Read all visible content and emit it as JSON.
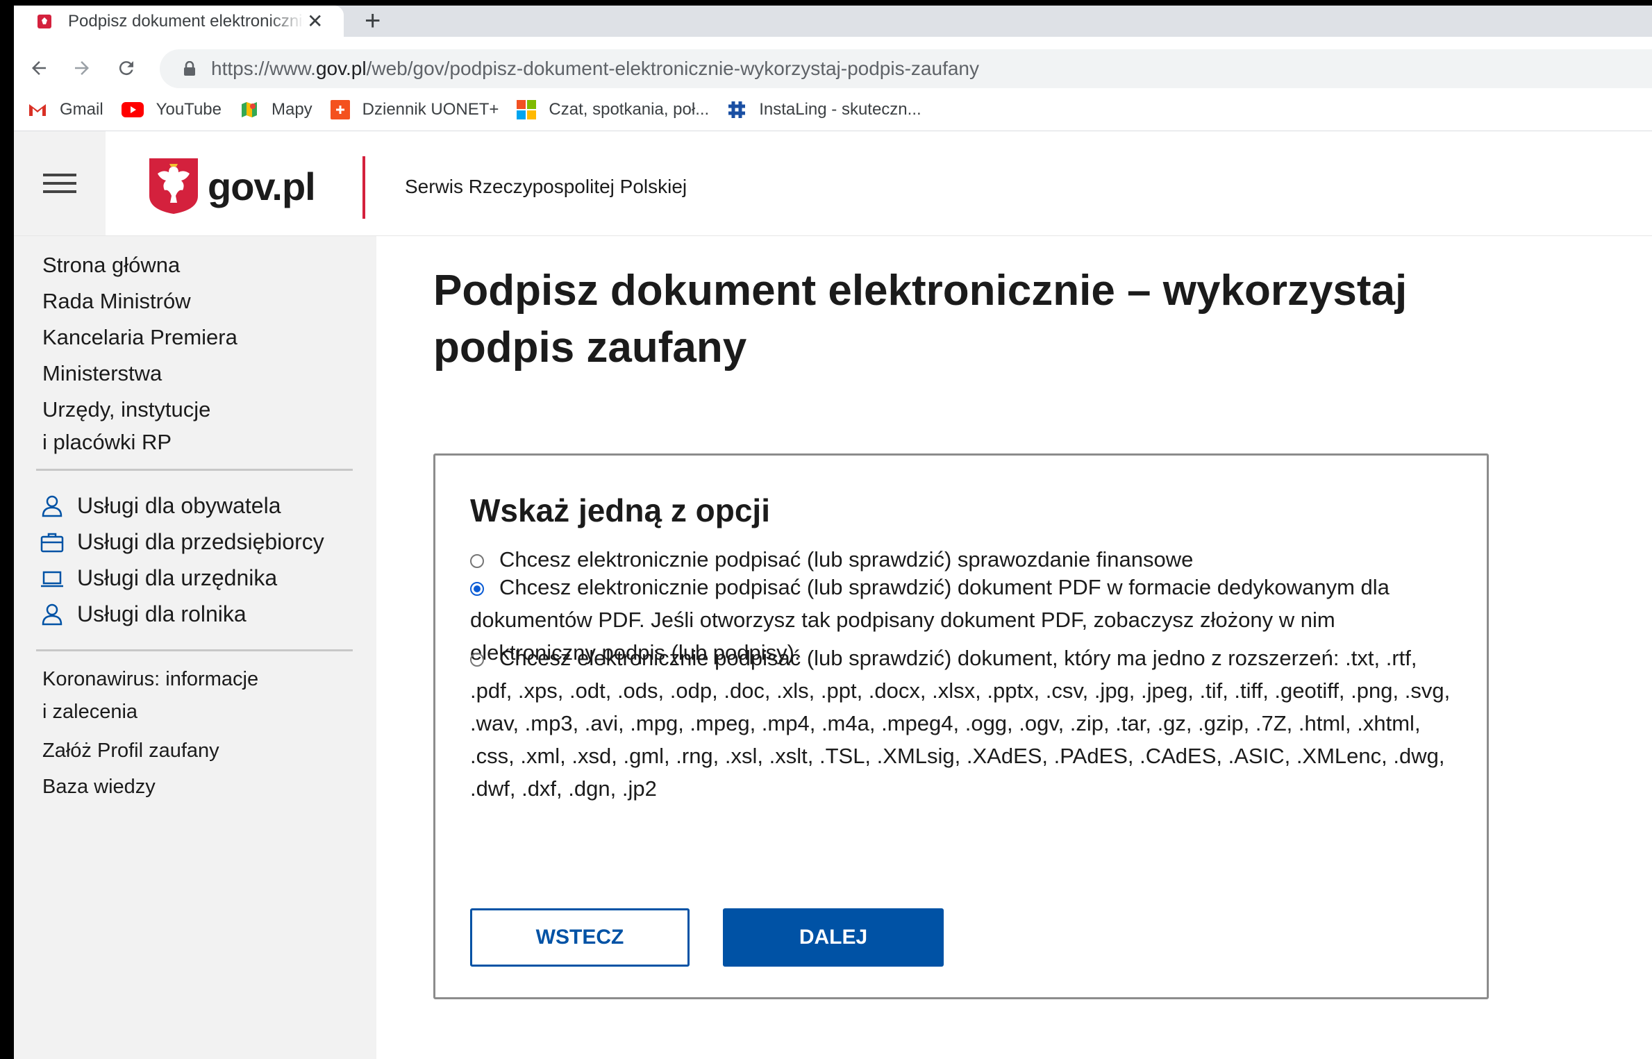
{
  "browser": {
    "tab_title": "Podpisz dokument elektronicznie - wykorzystaj podpis zaufany",
    "tab_close": "✕",
    "new_tab": "+",
    "url_host_prefix": "https://www.",
    "url_host": "gov.pl",
    "url_path": "/web/gov/podpisz-dokument-elektronicznie-wykorzystaj-podpis-zaufany",
    "bookmarks": [
      "Gmail",
      "YouTube",
      "Mapy",
      "Dziennik UONET+",
      "Czat, spotkania, poł...",
      "InstaLing - skuteczn..."
    ]
  },
  "header": {
    "logo_text": "gov.pl",
    "service_name": "Serwis Rzeczypospolitej Polskiej"
  },
  "sidebar": {
    "links": [
      "Strona główna",
      "Rada Ministrów",
      "Kancelaria Premiera",
      "Ministerstwa",
      "Urzędy, instytucje",
      "i placówki RP"
    ],
    "services": [
      "Usługi dla obywatela",
      "Usługi dla przedsiębiorcy",
      "Usługi dla urzędnika",
      "Usługi dla rolnika"
    ],
    "extra": [
      "Koronawirus: informacje",
      "i zalecenia",
      "Załóż Profil zaufany",
      "Baza wiedzy"
    ]
  },
  "main": {
    "title": "Podpisz dokument elektronicznie – wykorzystaj podpis zaufany",
    "options_heading": "Wskaż jedną z opcji",
    "options": [
      {
        "label": "Chcesz elektronicznie podpisać (lub sprawdzić) sprawozdanie finansowe",
        "checked": false
      },
      {
        "label": "Chcesz elektronicznie podpisać (lub sprawdzić) dokument PDF w formacie dedykowanym dla dokumentów PDF. Jeśli otworzysz tak podpisany dokument PDF, zobaczysz złożony w nim elektroniczny podpis (lub podpisy).",
        "checked": true
      },
      {
        "label": "Chcesz elektronicznie podpisać (lub sprawdzić) dokument, który ma jedno z rozszerzeń: .txt, .rtf, .pdf, .xps, .odt, .ods, .odp, .doc, .xls, .ppt, .docx, .xlsx, .pptx, .csv, .jpg, .jpeg, .tif, .tiff, .geotiff, .png, .svg, .wav, .mp3, .avi, .mpg, .mpeg, .mp4, .m4a, .mpeg4, .ogg, .ogv, .zip, .tar, .gz, .gzip, .7Z, .html, .xhtml, .css, .xml, .xsd, .gml, .rng, .xsl, .xslt, .TSL, .XMLsig, .XAdES, .PAdES, .CAdES, .ASIC, .XMLenc, .dwg, .dwf, .dxf, .dgn, .jp2",
        "checked": false
      }
    ],
    "back_label": "WSTECZ",
    "next_label": "DALEJ"
  },
  "colors": {
    "primary": "#0052a5",
    "accent_red": "#d4213d",
    "radio_checked": "#0b5cd5"
  }
}
